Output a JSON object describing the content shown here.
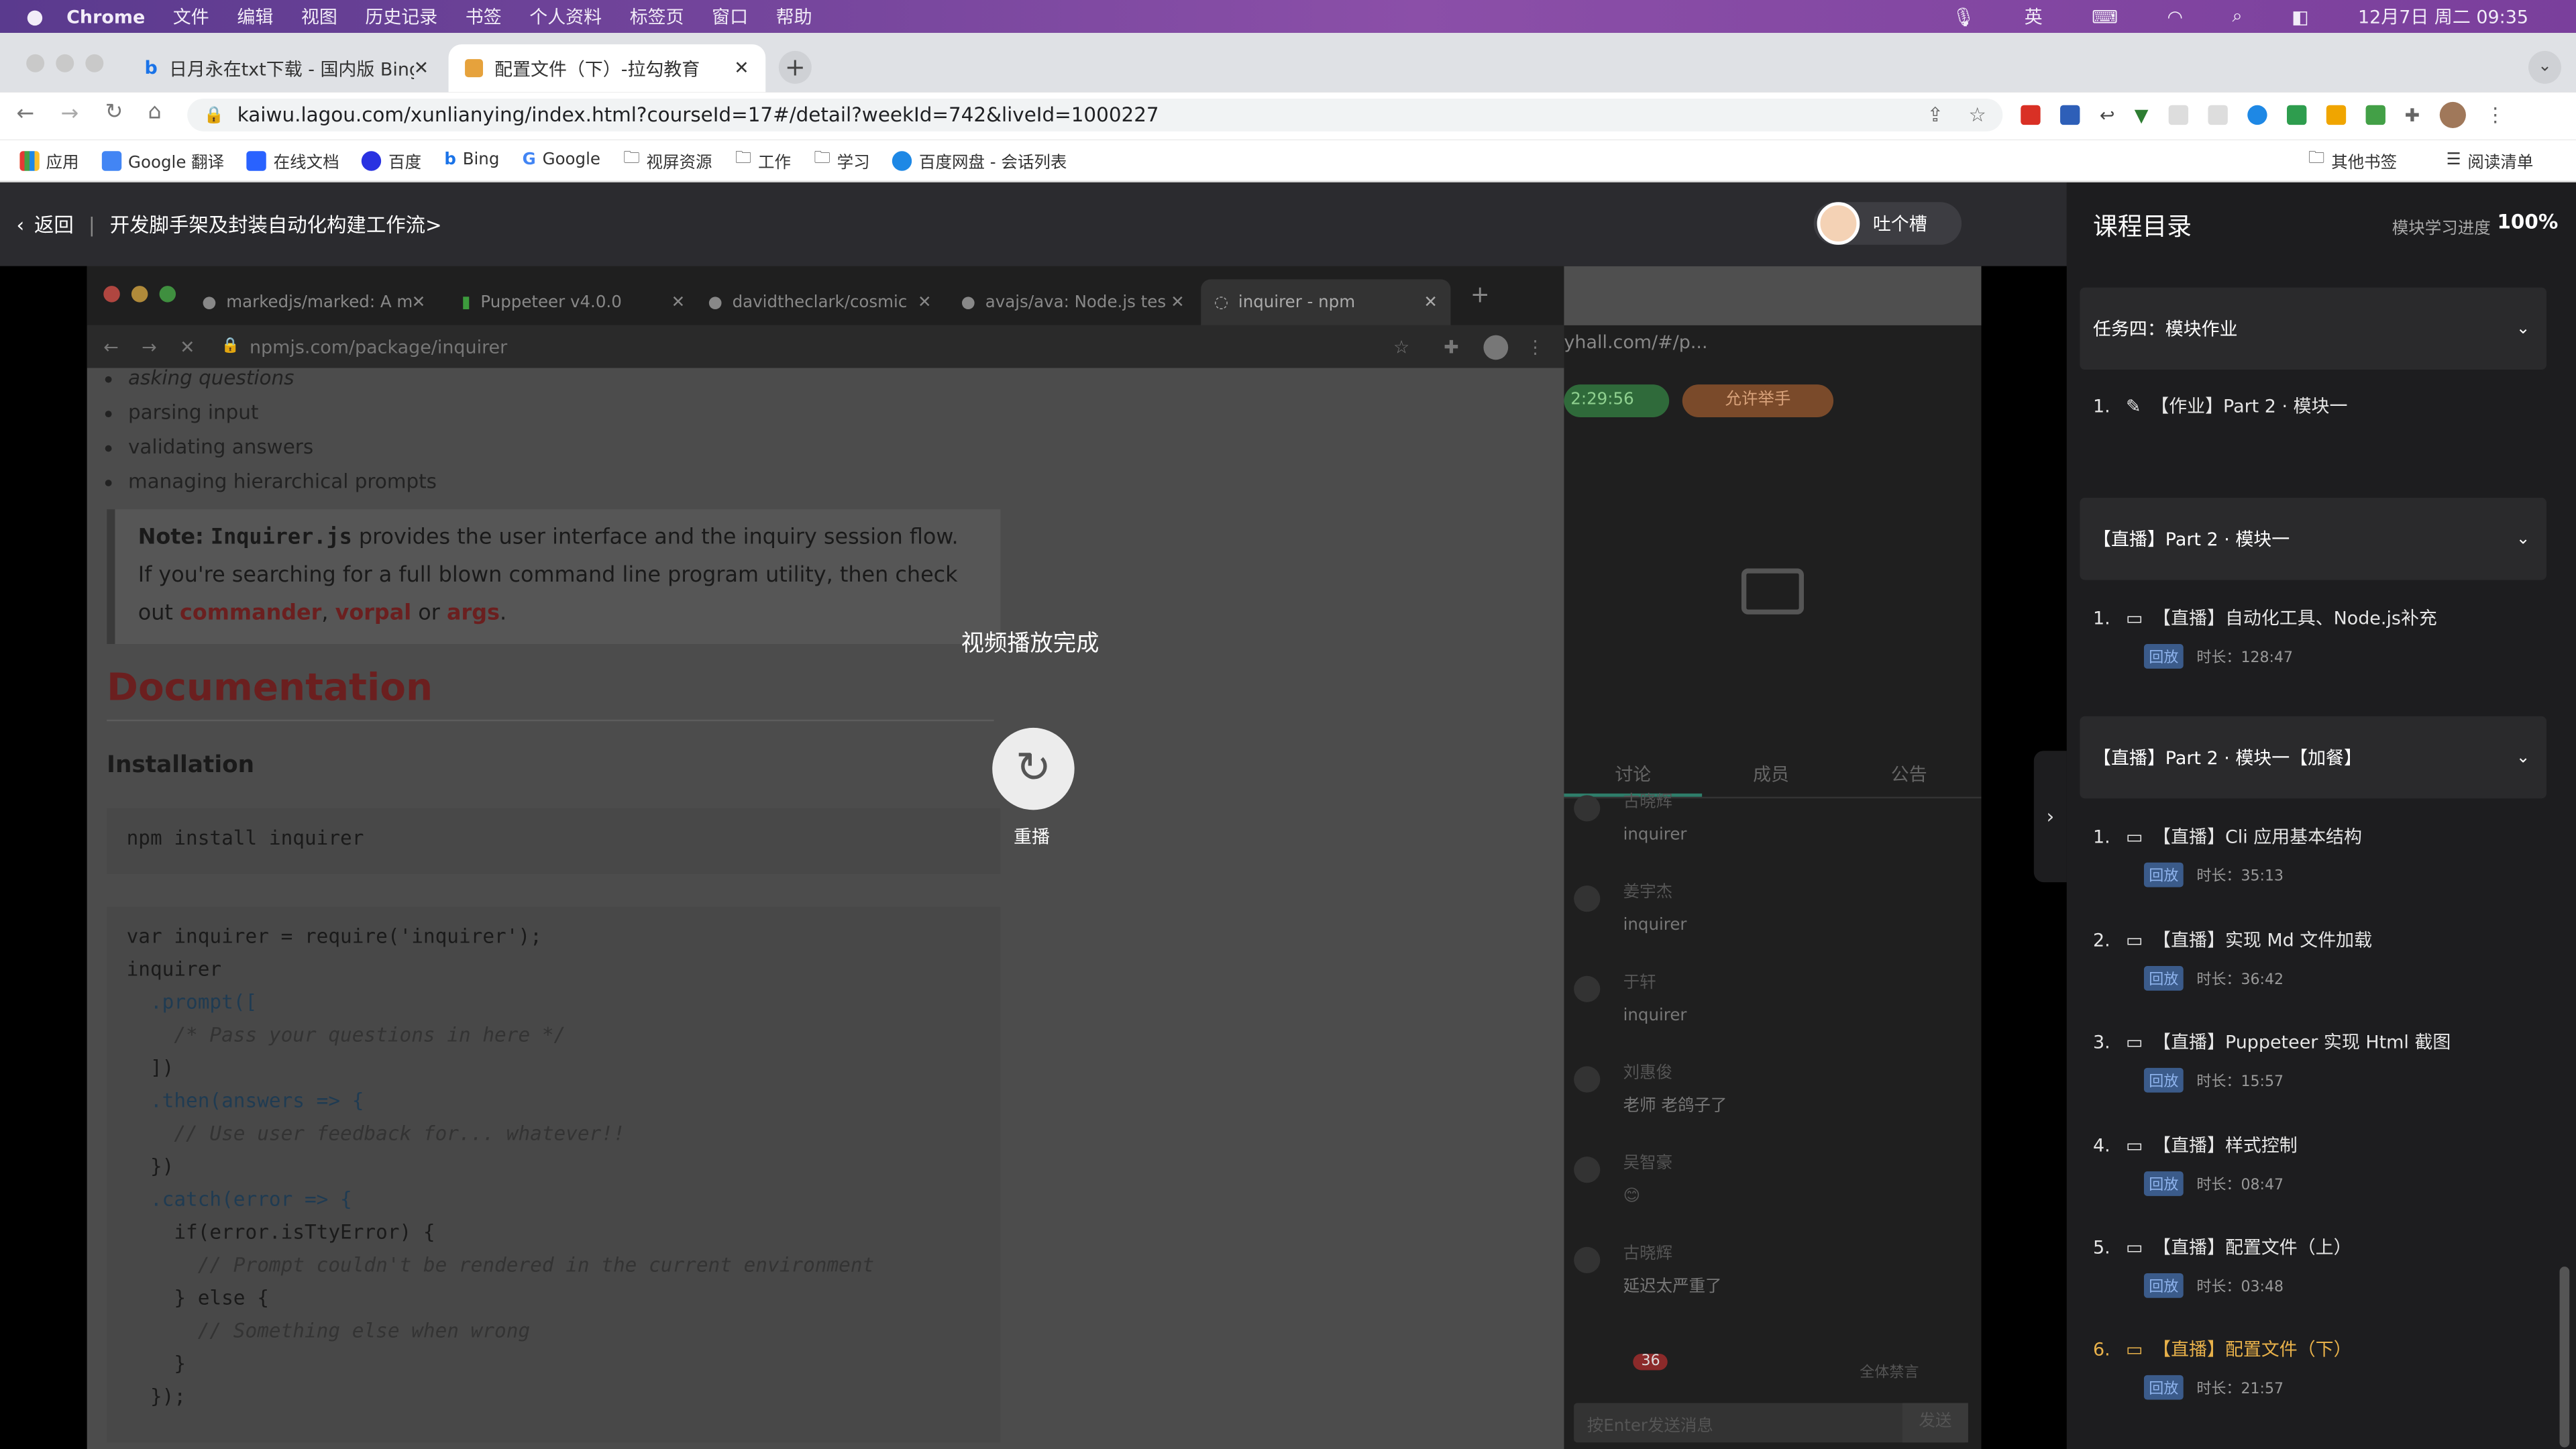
{
  "menubar": {
    "app": "Chrome",
    "items": [
      "文件",
      "编辑",
      "视图",
      "历史记录",
      "书签",
      "个人资料",
      "标签页",
      "窗口",
      "帮助"
    ],
    "ime": "英",
    "datetime": "12月7日 周二 09:35"
  },
  "tabs": [
    {
      "title": "日月永在txt下载 - 国内版 Bing"
    },
    {
      "title": "配置文件（下）-拉勾教育"
    }
  ],
  "url": "kaiwu.lagou.com/xunlianying/index.html?courseId=17#/detail?weekId=742&liveId=1000227",
  "bookmarks": [
    "应用",
    "Google 翻译",
    "在线文档",
    "百度",
    "Bing",
    "Google",
    "视屏资源",
    "工作",
    "学习",
    "百度网盘 - 会话列表"
  ],
  "bookmarks_right": [
    "其他书签",
    "阅读清单"
  ],
  "course_header": {
    "back": "返回",
    "title": "开发脚手架及封装自动化构建工作流>",
    "user": "吐个槽"
  },
  "video": {
    "inner_tabs": [
      "markedjs/marked: A m",
      "Puppeteer v4.0.0",
      "davidtheclark/cosmic",
      "avajs/ava: Node.js tes",
      "inquirer - npm"
    ],
    "inner_url": "npmjs.com/package/inquirer",
    "bullets": [
      "asking questions",
      "parsing input",
      "validating answers",
      "managing hierarchical prompts"
    ],
    "note_prefix": "Note:",
    "note_code": "Inquirer.js",
    "note_text": "provides the user interface and the inquiry session flow. If you're searching for a full blown command line program utility, then check out",
    "note_links": [
      "commander",
      "vorpal",
      "args"
    ],
    "note_or": "or",
    "heading": "Documentation",
    "subheading": "Installation",
    "install_cmd": "npm install inquirer",
    "code_lines": [
      "var inquirer = require('inquirer');",
      "inquirer",
      "  .prompt([",
      "    /* Pass your questions in here */",
      "  ])",
      "  .then(answers => {",
      "    // Use user feedback for... whatever!!",
      "  })",
      "  .catch(error => {",
      "    if(error.isTtyError) {",
      "      // Prompt couldn't be rendered in the current environment",
      "    } else {",
      "      // Something else when wrong",
      "    }",
      "  });"
    ],
    "side_url": "yhall.com/#/p...",
    "side_timer": "2:29:56",
    "side_btn": "允许举手",
    "side_tabs": [
      "讨论",
      "成员",
      "公告"
    ],
    "chat": [
      {
        "name": "古晓辉",
        "msg": "inquirer"
      },
      {
        "name": "姜宇杰",
        "msg": "inquirer"
      },
      {
        "name": "于轩",
        "msg": "inquirer"
      },
      {
        "name": "刘惠俊",
        "msg": "老师 老鸽子了"
      },
      {
        "name": "吴智豪",
        "msg": "😊"
      },
      {
        "name": "古晓辉",
        "msg": "延迟太严重了"
      }
    ],
    "chat_count": "36",
    "mute_all": "全体禁言",
    "chat_placeholder": "按Enter发送消息",
    "send": "发送",
    "finished": "视频播放完成",
    "replay": "重播"
  },
  "directory": {
    "title": "课程目录",
    "progress_label": "模块学习进度",
    "progress": "100%",
    "sections": [
      {
        "title": "任务四：模块作业",
        "items": [
          {
            "no": "1.",
            "title": "【作业】Part 2 · 模块一",
            "icon": "edit-icon"
          }
        ]
      },
      {
        "title": "【直播】Part 2 · 模块一",
        "items": [
          {
            "no": "1.",
            "title": "【直播】自动化工具、Node.js补充",
            "badge": "回放",
            "duration": "时长：128:47"
          }
        ]
      },
      {
        "title": "【直播】Part 2 · 模块一【加餐】",
        "items": [
          {
            "no": "1.",
            "title": "【直播】Cli 应用基本结构",
            "badge": "回放",
            "duration": "时长：35:13"
          },
          {
            "no": "2.",
            "title": "【直播】实现 Md 文件加载",
            "badge": "回放",
            "duration": "时长：36:42"
          },
          {
            "no": "3.",
            "title": "【直播】Puppeteer 实现 Html 截图",
            "badge": "回放",
            "duration": "时长：15:57"
          },
          {
            "no": "4.",
            "title": "【直播】样式控制",
            "badge": "回放",
            "duration": "时长：08:47"
          },
          {
            "no": "5.",
            "title": "【直播】配置文件（上）",
            "badge": "回放",
            "duration": "时长：03:48"
          },
          {
            "no": "6.",
            "title": "【直播】配置文件（下）",
            "badge": "回放",
            "duration": "时长：21:57",
            "active": "true"
          }
        ]
      }
    ]
  },
  "colors": {
    "accent": "#e8b14a",
    "link": "#c0392b",
    "badge_bg": "#3b5b8a"
  }
}
